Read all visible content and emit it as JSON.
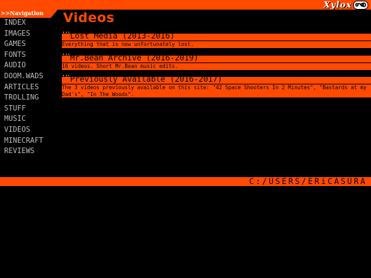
{
  "header": {
    "nav_label": ">>Navigation",
    "logo_text": "Xylox",
    "logo_badge_icon": "infinity-icon"
  },
  "page": {
    "title": "Videos"
  },
  "sidebar": {
    "items": [
      {
        "label": "Index"
      },
      {
        "label": "Images"
      },
      {
        "label": "Games"
      },
      {
        "label": "Fonts"
      },
      {
        "label": "Audio"
      },
      {
        "label": "Doom.wads"
      },
      {
        "label": "Articles"
      },
      {
        "label": "Trolling"
      },
      {
        "label": "Stuff"
      },
      {
        "label": "Music"
      },
      {
        "label": "Videos"
      },
      {
        "label": "Minecraft"
      },
      {
        "label": "Reviews"
      }
    ]
  },
  "entries": [
    {
      "title": "Lost Media (2013-2016)",
      "description": "Everything that is now unfortunately lost."
    },
    {
      "title": "Mr.Bean Archive (2016-2019)",
      "description": "16 videos. Short Mr.Bean music edits."
    },
    {
      "title": "Previously Available (2016-2017)",
      "description": "The 3 videos previously available on this site: \"42 Space Shooters In 2 Minutes\", \"Bastards at my Dad's\", \"In The Woods\"."
    }
  ],
  "footer": {
    "path": "C:/USERS/ERiCASURA"
  },
  "colors": {
    "accent": "#ff4a00",
    "background": "#000000",
    "nav_text": "#bdbdbd"
  }
}
